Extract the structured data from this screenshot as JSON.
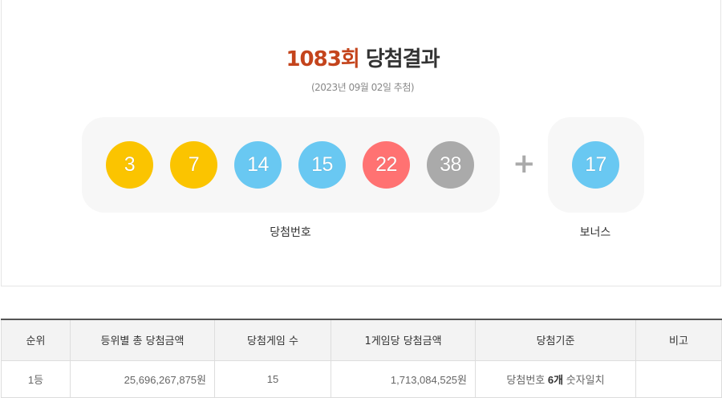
{
  "result": {
    "round_number": "1083회",
    "round_suffix": "당첨결과",
    "draw_date": "(2023년 09월 02일 추첨)",
    "winning_label": "당첨번호",
    "bonus_label": "보너스",
    "plus_symbol": "+"
  },
  "balls": [
    {
      "number": "3",
      "color": "#fbc400"
    },
    {
      "number": "7",
      "color": "#fbc400"
    },
    {
      "number": "14",
      "color": "#69c8f2"
    },
    {
      "number": "15",
      "color": "#69c8f2"
    },
    {
      "number": "22",
      "color": "#ff7272"
    },
    {
      "number": "38",
      "color": "#aaaaaa"
    }
  ],
  "bonus_ball": {
    "number": "17",
    "color": "#69c8f2"
  },
  "table": {
    "headers": [
      "순위",
      "등위별 총 당첨금액",
      "당첨게임 수",
      "1게임당 당첨금액",
      "당첨기준",
      "비고"
    ],
    "rows": [
      {
        "rank": "1등",
        "total_prize": "25,696,267,875원",
        "winners": "15",
        "prize_per_game": "1,713,084,525원",
        "standard_prefix": "당첨번호",
        "standard_count": "6개",
        "standard_suffix": "숫자일치",
        "note": ""
      }
    ]
  }
}
